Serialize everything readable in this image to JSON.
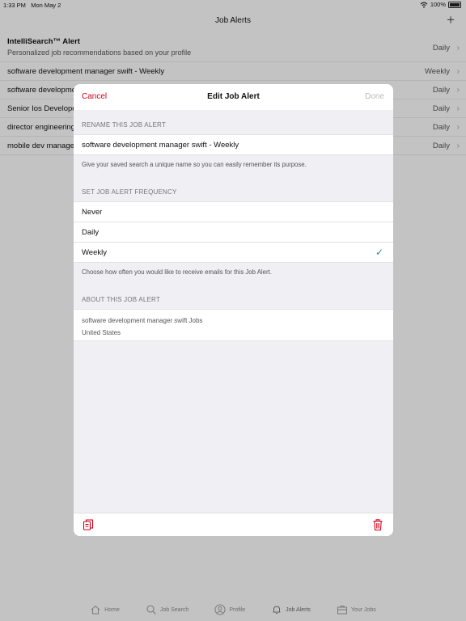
{
  "status_bar": {
    "time": "1:33 PM",
    "date": "Mon May 2",
    "battery": "100%"
  },
  "nav": {
    "title": "Job Alerts",
    "add_icon": "plus-icon"
  },
  "alerts": [
    {
      "name": "IntelliSearch™ Alert",
      "subtitle": "Personalized job recommendations based on your profile",
      "frequency": "Daily"
    },
    {
      "name": "software development manager swift - Weekly",
      "frequency": "Weekly"
    },
    {
      "name": "software development manager swift",
      "frequency": "Daily"
    },
    {
      "name": "Senior Ios Developer",
      "frequency": "Daily"
    },
    {
      "name": "director engineering",
      "frequency": "Daily"
    },
    {
      "name": "mobile dev manager",
      "frequency": "Daily"
    }
  ],
  "tabs": [
    {
      "label": "Home",
      "icon": "home-icon"
    },
    {
      "label": "Job Search",
      "icon": "search-icon"
    },
    {
      "label": "Profile",
      "icon": "profile-icon"
    },
    {
      "label": "Job Alerts",
      "icon": "bell-icon"
    },
    {
      "label": "Your Jobs",
      "icon": "briefcase-icon"
    }
  ],
  "modal": {
    "cancel_label": "Cancel",
    "title": "Edit Job Alert",
    "done_label": "Done",
    "rename_header": "RENAME THIS JOB ALERT",
    "name_value": "software development manager swift - Weekly",
    "rename_footer": "Give your saved search a unique name so you can easily remember its purpose.",
    "frequency_header": "SET JOB ALERT FREQUENCY",
    "frequency_options": [
      "Never",
      "Daily",
      "Weekly"
    ],
    "selected_frequency": "Weekly",
    "frequency_footer": "Choose how often you would like to receive emails for this Job Alert.",
    "about_header": "ABOUT THIS JOB ALERT",
    "about_query": "software development manager swift Jobs",
    "about_location": "United States",
    "copy_icon": "copy-icon",
    "trash_icon": "trash-icon"
  },
  "colors": {
    "accent": "#d0021b",
    "check": "#2a8a9a"
  }
}
